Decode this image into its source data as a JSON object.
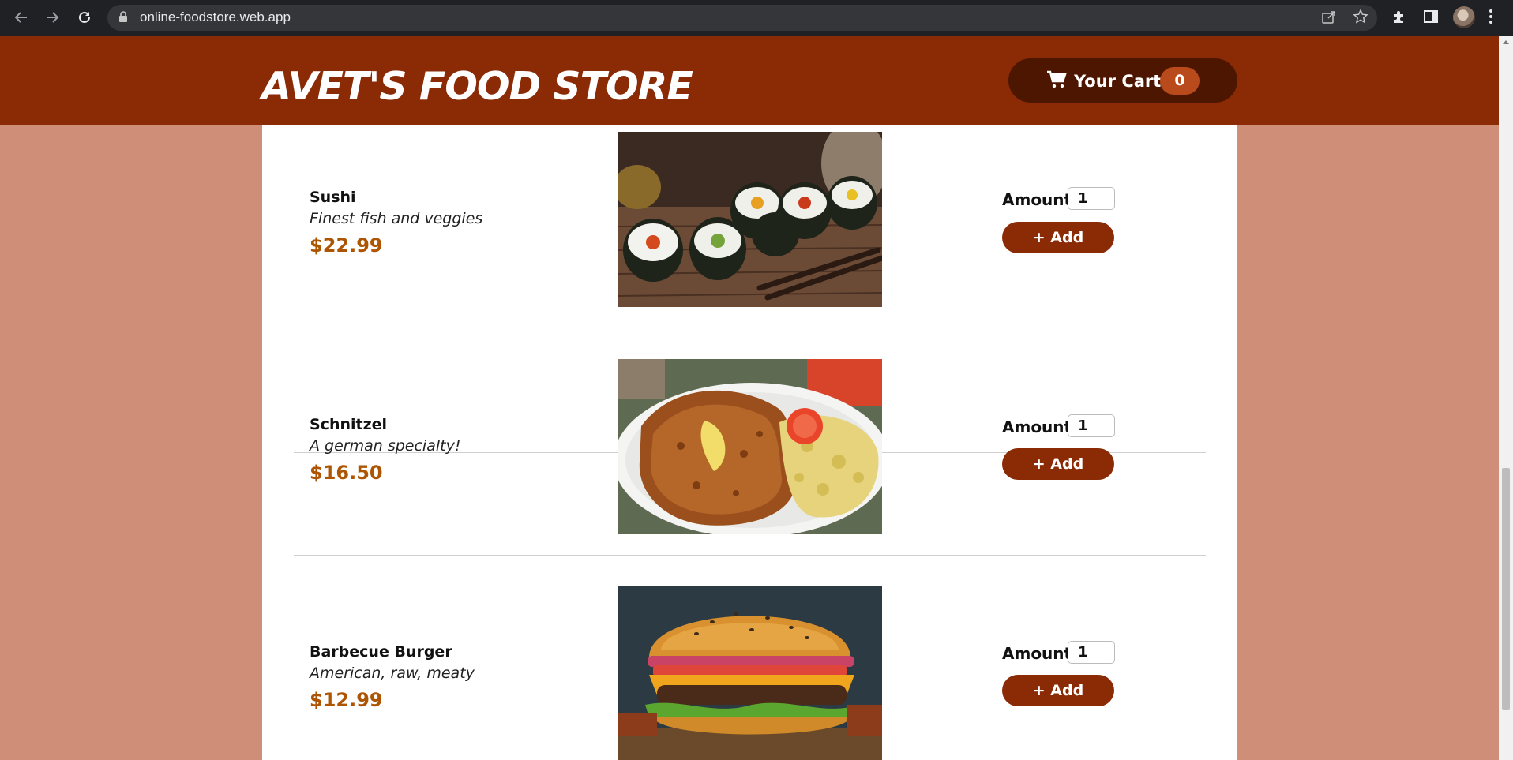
{
  "browser": {
    "url": "online-foodstore.web.app",
    "icons": [
      "back-arrow-icon",
      "forward-arrow-icon",
      "reload-icon",
      "lock-icon",
      "share-icon",
      "star-icon",
      "puzzle-icon",
      "side-panel-icon",
      "profile-avatar",
      "kebab-menu-icon"
    ]
  },
  "header": {
    "title": "AVET'S FOOD STORE",
    "cart_label": "Your Cart",
    "cart_count": "0",
    "cart_icon": "shopping-cart-icon"
  },
  "meals": [
    {
      "name": "Sushi",
      "description": "Finest fish and veggies",
      "price": "$22.99",
      "amount_label": "Amount",
      "amount": "1",
      "add_label": "+ Add",
      "image": "sushi-rolls-photo"
    },
    {
      "name": "Schnitzel",
      "description": "A german specialty!",
      "price": "$16.50",
      "amount_label": "Amount",
      "amount": "1",
      "add_label": "+ Add",
      "image": "schnitzel-plate-photo"
    },
    {
      "name": "Barbecue Burger",
      "description": "American, raw, meaty",
      "price": "$12.99",
      "amount_label": "Amount",
      "amount": "1",
      "add_label": "+ Add",
      "image": "burger-photo"
    }
  ],
  "colors": {
    "page_bg": "#cf8e78",
    "header_bg": "#8a2b06",
    "cart_bg": "#4d1601",
    "badge_bg": "#b94a1c",
    "price": "#ad5502",
    "button": "#8a2b06"
  }
}
